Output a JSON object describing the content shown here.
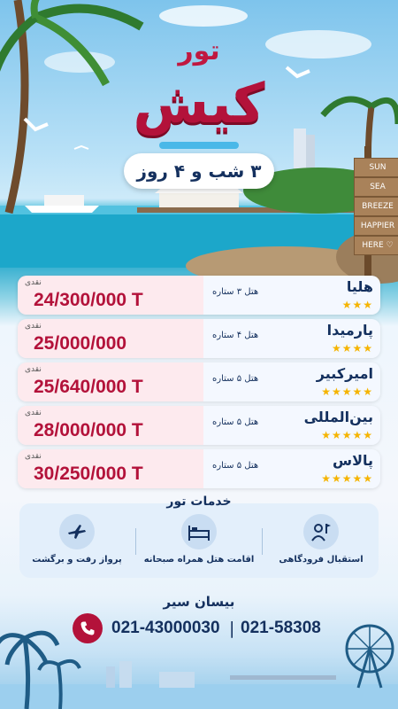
{
  "title": {
    "small": "تور",
    "big": "کیش",
    "duration": "۳ شب و ۴ روز"
  },
  "signpost": [
    "SUN",
    "SEA",
    "BREEZE",
    "HAPPIER",
    "HERE ♡"
  ],
  "price_label": "نقدی",
  "hotels": [
    {
      "name": "هلیا",
      "rating": "هتل ۳ ستاره",
      "stars": "★★★",
      "price": "24/300/000 T"
    },
    {
      "name": "پارمیدا",
      "rating": "هتل ۴ ستاره",
      "stars": "★★★★",
      "price": "25/000/000"
    },
    {
      "name": "امیرکبیر",
      "rating": "هتل ۵ ستاره",
      "stars": "★★★★★",
      "price": "25/640/000 T"
    },
    {
      "name": "بین‌المللی",
      "rating": "هتل ۵ ستاره",
      "stars": "★★★★★",
      "price": "28/000/000 T"
    },
    {
      "name": "پالاس",
      "rating": "هتل ۵ ستاره",
      "stars": "★★★★★",
      "price": "30/250/000 T"
    }
  ],
  "services": {
    "title": "خدمات تور",
    "items": [
      {
        "label": "پرواز رفت و برگشت",
        "icon": "airplane-icon"
      },
      {
        "label": "اقامت هتل همراه صبحانه",
        "icon": "bed-icon"
      },
      {
        "label": "استقبال فرودگاهی",
        "icon": "greeter-flag-icon"
      }
    ]
  },
  "contact": {
    "brand": "بیسان سیر",
    "phone1": "021-43000030",
    "separator": "|",
    "phone2": "021-58308"
  },
  "colors": {
    "accent": "#b3123a",
    "navy": "#14305e",
    "star": "#f5b400"
  }
}
